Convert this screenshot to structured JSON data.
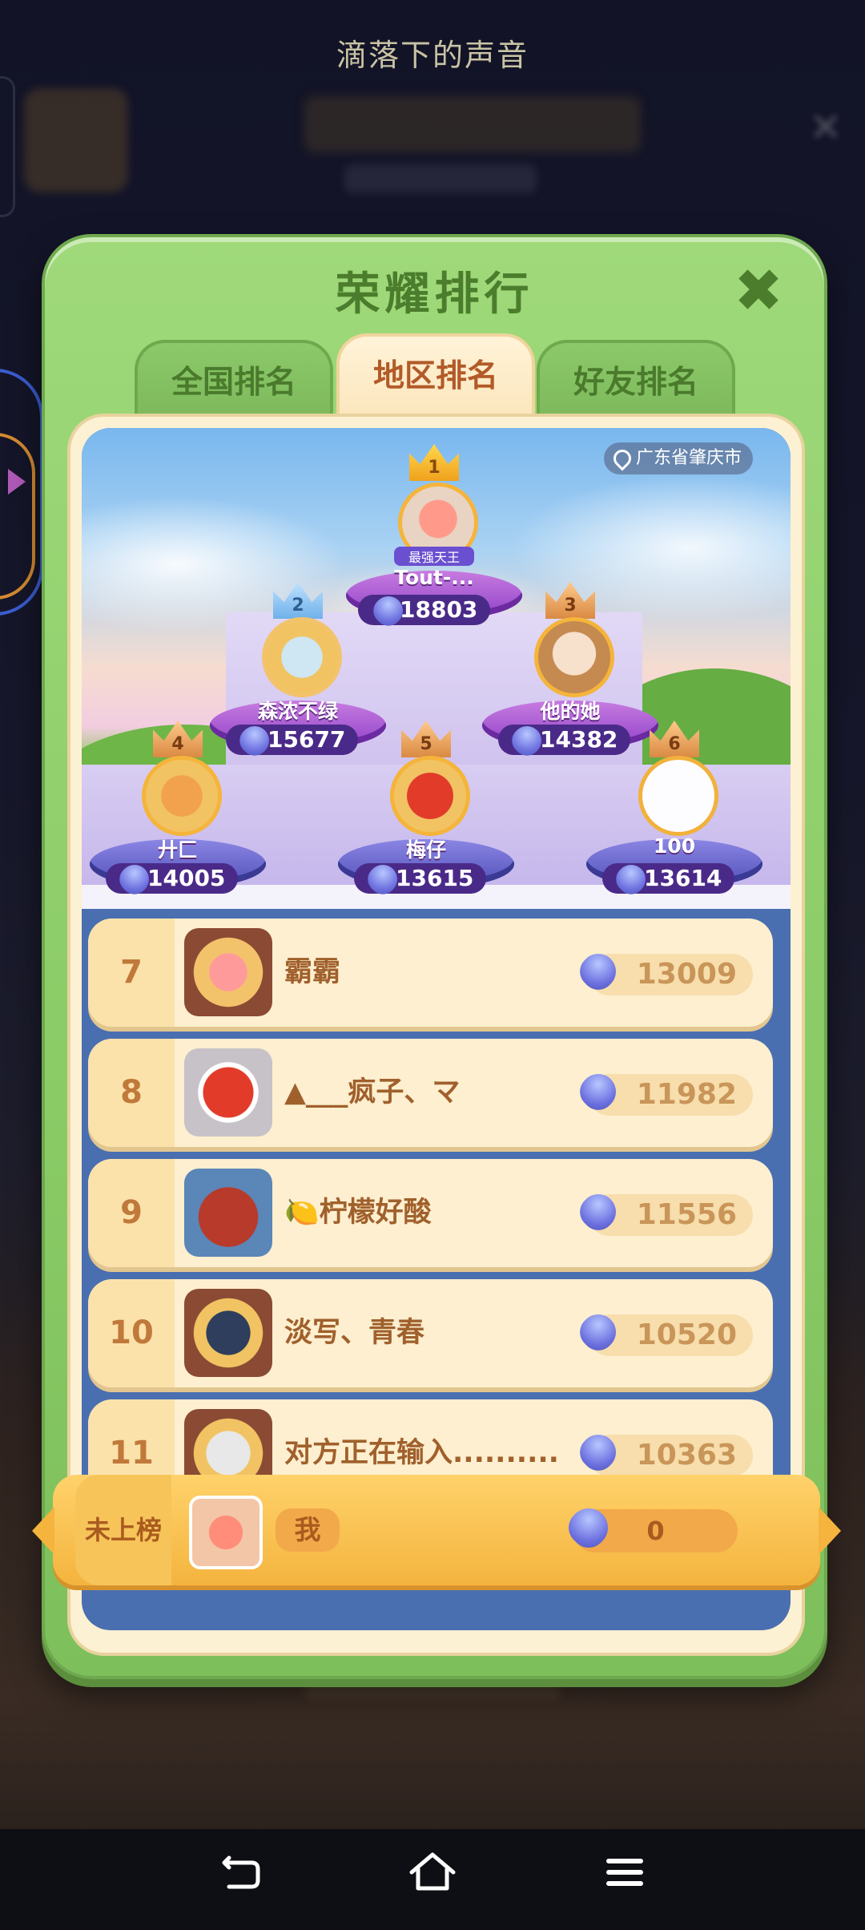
{
  "top_title": "滴落下的声音",
  "modal": {
    "title": "荣耀排行",
    "close_icon": "close-icon",
    "tabs": [
      {
        "label": "全国排名",
        "active": false
      },
      {
        "label": "地区排名",
        "active": true
      },
      {
        "label": "好友排名",
        "active": false
      }
    ],
    "location": "广东省肇庆市"
  },
  "podium": [
    {
      "rank": "1",
      "name": "Tout-...",
      "score": "18803",
      "badge": "最强天王"
    },
    {
      "rank": "2",
      "name": "森浓不绿",
      "score": "15677"
    },
    {
      "rank": "3",
      "name": "他的她",
      "score": "14382"
    },
    {
      "rank": "4",
      "name": "廾匚",
      "score": "14005"
    },
    {
      "rank": "5",
      "name": "梅仔",
      "score": "13615"
    },
    {
      "rank": "6",
      "name": "100",
      "score": "13614"
    }
  ],
  "list": [
    {
      "rank": "7",
      "name": "霸霸",
      "score": "13009"
    },
    {
      "rank": "8",
      "name": "▲___疯子、マ",
      "score": "11982"
    },
    {
      "rank": "9",
      "name": "🍋柠檬好酸",
      "score": "11556"
    },
    {
      "rank": "10",
      "name": "淡写、青春",
      "score": "10520"
    },
    {
      "rank": "11",
      "name": "对方正在输入..........",
      "score": "10363"
    }
  ],
  "me": {
    "rank_label": "未上榜",
    "name": "我",
    "score": "0"
  },
  "navbar": {
    "back_icon": "back-icon",
    "home_icon": "home-icon",
    "menu_icon": "menu-icon"
  },
  "colors": {
    "modal_green": "#8acb66",
    "title_green": "#4b7d2c",
    "tab_active_text": "#b25a28",
    "row_bg": "#fdefcf"
  }
}
